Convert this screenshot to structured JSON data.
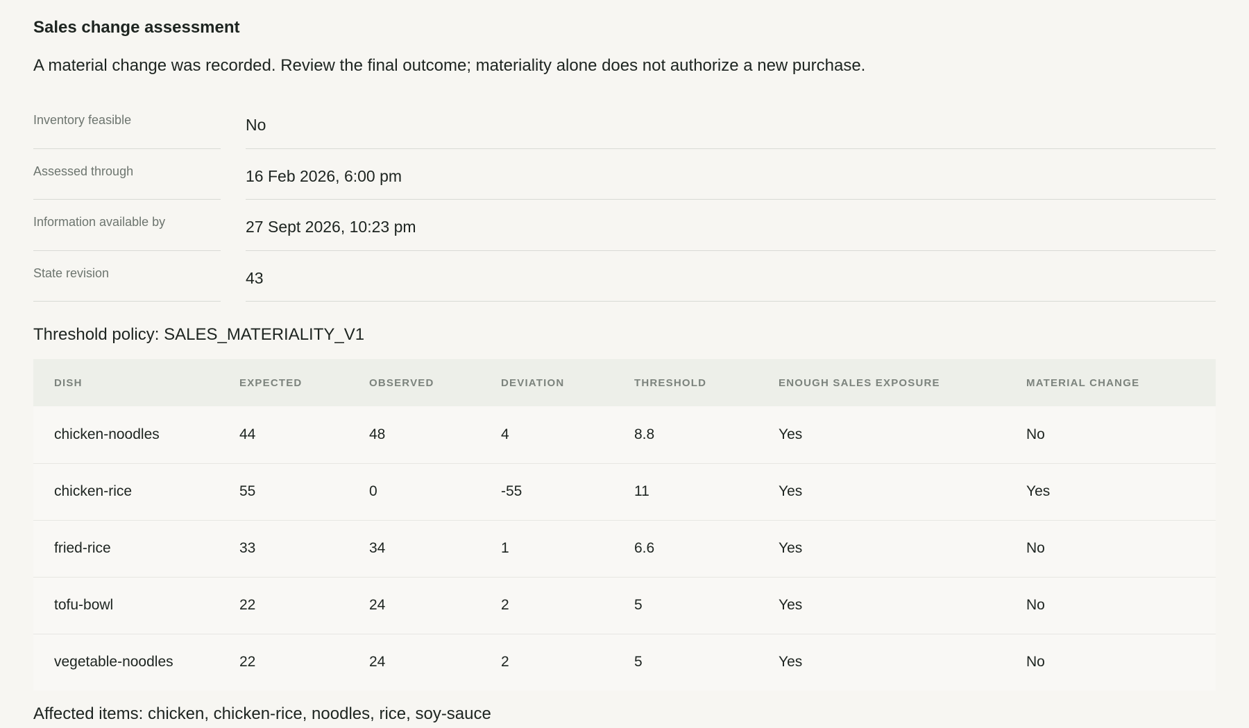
{
  "assessment": {
    "title": "Sales change assessment",
    "summary": "A material change was recorded. Review the final outcome; materiality alone does not authorize a new purchase."
  },
  "details": [
    {
      "label": "Inventory feasible",
      "value": "No"
    },
    {
      "label": "Assessed through",
      "value": "16 Feb 2026, 6:00 pm"
    },
    {
      "label": "Information available by",
      "value": "27 Sept 2026, 10:23 pm"
    },
    {
      "label": "State revision",
      "value": "43"
    }
  ],
  "policy": {
    "text": "Threshold policy: SALES_MATERIALITY_V1"
  },
  "table": {
    "headers": [
      "DISH",
      "EXPECTED",
      "OBSERVED",
      "DEVIATION",
      "THRESHOLD",
      "ENOUGH SALES EXPOSURE",
      "MATERIAL CHANGE"
    ],
    "rows": [
      [
        "chicken-noodles",
        "44",
        "48",
        "4",
        "8.8",
        "Yes",
        "No"
      ],
      [
        "chicken-rice",
        "55",
        "0",
        "-55",
        "11",
        "Yes",
        "Yes"
      ],
      [
        "fried-rice",
        "33",
        "34",
        "1",
        "6.6",
        "Yes",
        "No"
      ],
      [
        "tofu-bowl",
        "22",
        "24",
        "2",
        "5",
        "Yes",
        "No"
      ],
      [
        "vegetable-noodles",
        "22",
        "24",
        "2",
        "5",
        "Yes",
        "No"
      ]
    ]
  },
  "affected": {
    "text": "Affected items: chicken, chicken-rice, noodles, rice, soy-sauce"
  }
}
